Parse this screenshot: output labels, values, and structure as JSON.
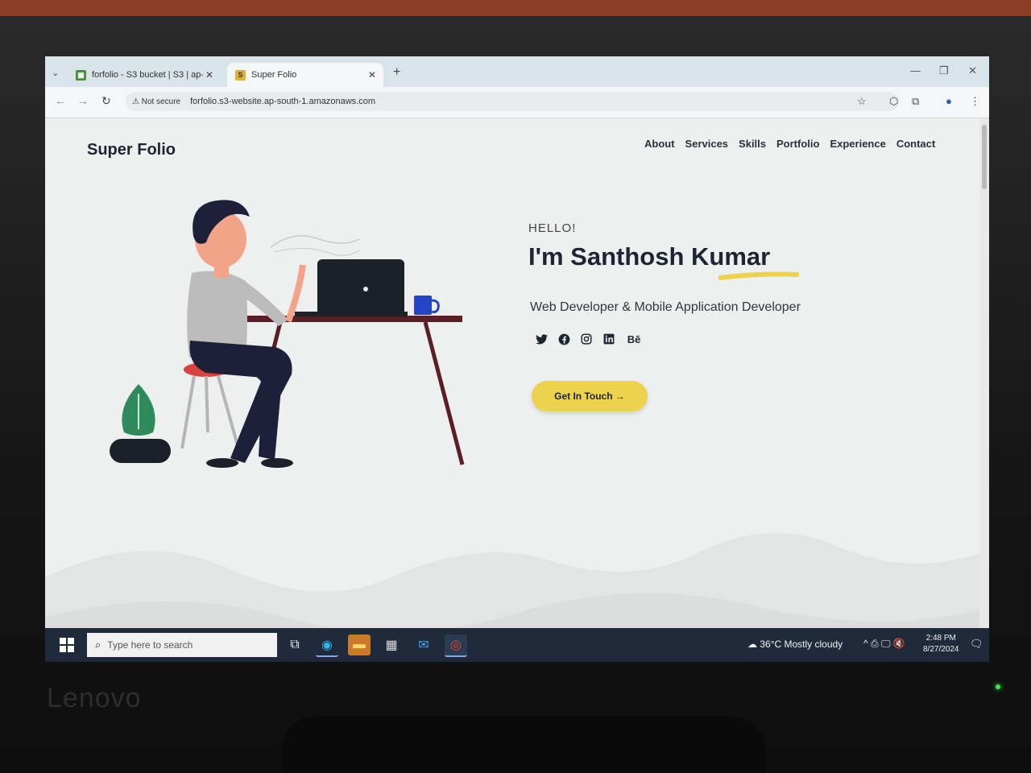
{
  "browser": {
    "tabs": [
      {
        "title": "forfolio - S3 bucket | S3 | ap-so",
        "favicon": "s3-icon",
        "active": false
      },
      {
        "title": "Super Folio",
        "favicon": "S",
        "active": true
      }
    ],
    "security_label": "Not secure",
    "url": "forfolio.s3-website.ap-south-1.amazonaws.com"
  },
  "site": {
    "logo": "Super Folio",
    "nav": [
      "About",
      "Services",
      "Skills",
      "Portfolio",
      "Experience",
      "Contact"
    ],
    "greeting": "HELLO!",
    "headline": "I'm Santhosh Kumar",
    "subtitle": "Web Developer & Mobile Application Developer",
    "social": [
      "twitter-icon",
      "facebook-icon",
      "instagram-icon",
      "linkedin-icon",
      "behance-icon"
    ],
    "behance_label": "Bē",
    "cta_label": "Get In Touch →",
    "accent_color": "#ecd24d",
    "text_color": "#1e2532"
  },
  "taskbar": {
    "search_placeholder": "Type here to search",
    "weather": "36°C  Mostly cloudy",
    "time": "2:48 PM",
    "date": "8/27/2024"
  },
  "monitor": {
    "brand": "Lenovo"
  }
}
